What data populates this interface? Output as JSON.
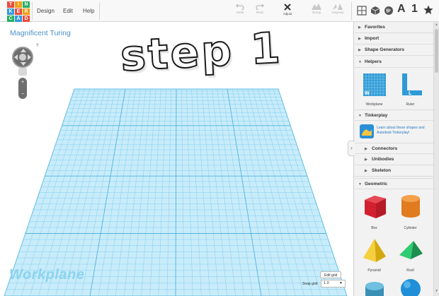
{
  "app": {
    "logo_letters": [
      "TIN",
      "KER",
      "CAD"
    ],
    "logo_colors": [
      "#e84b3c",
      "#f39c12",
      "#27ae60",
      "#3498db"
    ]
  },
  "menu": {
    "design": "Design",
    "edit": "Edit",
    "help": "Help"
  },
  "toolbar": {
    "undo": "Undo",
    "redo": "Redo",
    "adjust": "Adjust",
    "group": "Group",
    "ungroup": "Ungroup"
  },
  "view_tools": {
    "letter_a": "A",
    "number_one": "1"
  },
  "design": {
    "title": "Magnificent Turing",
    "text_shape": "step 1"
  },
  "canvas": {
    "workplane_label": "Workplane",
    "edit_grid": "Edit grid",
    "snap_grid_label": "Snap grid",
    "snap_grid_value": "1.0",
    "help_mark": "?",
    "zoom_in": "+",
    "zoom_out": "−"
  },
  "panel": {
    "favorites": "Favorites",
    "import": "Import",
    "shape_generators": "Shape Generators",
    "helpers": "Helpers",
    "helpers_items": [
      "Workplane",
      "Ruler"
    ],
    "tinkerplay": "Tinkerplay",
    "tinkerplay_text": "Learn about these shapes and Autodesk Tinkerplay!",
    "connectors": "Connectors",
    "unibodies": "Unibodies",
    "skeleton": "Skeleton",
    "geometric": "Geometric",
    "geometric_items": [
      "Box",
      "Cylinder",
      "Pyramid",
      "Roof"
    ],
    "colors": {
      "box": "#d3202f",
      "cylinder": "#e67e22",
      "pyramid": "#f1c40f",
      "roof": "#27ae60",
      "sphere": "#1f8fd8",
      "blue_cyl": "#4aa3c9"
    }
  }
}
